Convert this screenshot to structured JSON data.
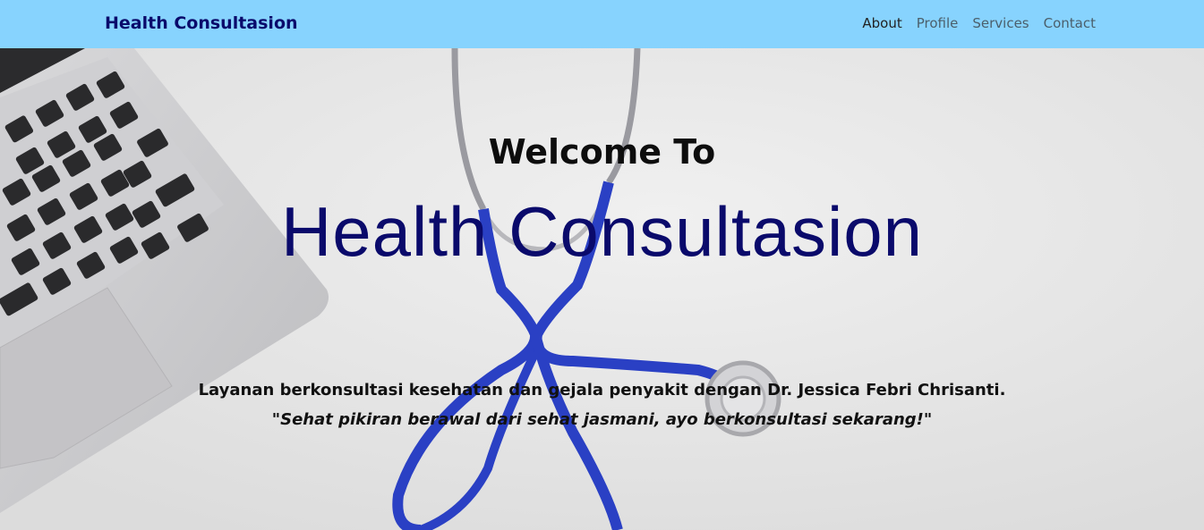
{
  "navbar": {
    "brand": "Health Consultasion",
    "links": [
      {
        "label": "About",
        "active": true
      },
      {
        "label": "Profile",
        "active": false
      },
      {
        "label": "Services",
        "active": false
      },
      {
        "label": "Contact",
        "active": false
      }
    ],
    "background_color": "#87d3fe",
    "brand_color": "#0a0a6b"
  },
  "hero": {
    "welcome": "Welcome To",
    "title": "Health Consultasion",
    "description": "Layanan berkonsultasi kesehatan dan gejala penyakit dengan Dr. Jessica Febri Chrisanti.",
    "quote": "\"Sehat pikiran berawal dari sehat jasmani, ayo berkonsultasi sekarang!\"",
    "background_image": "laptop-and-stethoscope-photo",
    "title_color": "#0a0a6b"
  }
}
